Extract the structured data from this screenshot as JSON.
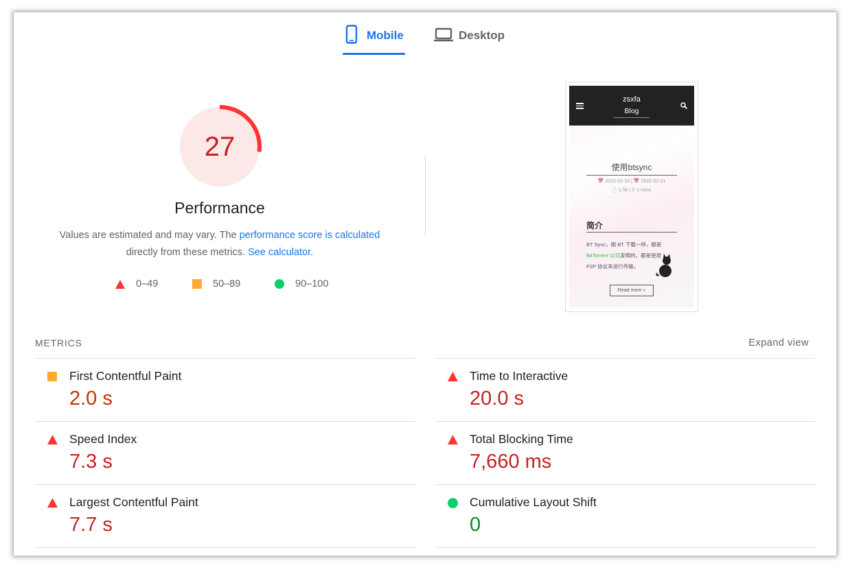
{
  "tabs": {
    "mobile_label": "Mobile",
    "desktop_label": "Desktop",
    "active": "mobile"
  },
  "score": {
    "value": "27",
    "fraction": 0.27,
    "title": "Performance",
    "desc_prefix": "Values are estimated and may vary. The ",
    "desc_link1": "performance score is calculated",
    "desc_middle": " directly from these metrics. ",
    "desc_link2": "See calculator",
    "desc_suffix": "."
  },
  "legend": {
    "poor": "0–49",
    "average": "50–89",
    "good": "90–100"
  },
  "screenshot": {
    "site_name": "zsxfa",
    "site_sub": "Blog",
    "post_title": "使用btsync",
    "meta_line1": "📅 2022-02-16  |  📅 2022-02-21",
    "meta_line2": "📄 1.5k  |  ⏱ 1 mins.",
    "section": "简介",
    "para_a": "BT Sync，跟 BT 下载一样，都是",
    "para_link": "BitTorrent 公司",
    "para_b": "发明的，都是使用",
    "para_c": "P2P 协议来进行传输。",
    "read_more": "Read more »"
  },
  "metrics": {
    "heading": "METRICS",
    "expand": "Expand view",
    "left": [
      {
        "name": "First Contentful Paint",
        "value": "2.0 s",
        "status": "average"
      },
      {
        "name": "Speed Index",
        "value": "7.3 s",
        "status": "poor"
      },
      {
        "name": "Largest Contentful Paint",
        "value": "7.7 s",
        "status": "poor"
      }
    ],
    "right": [
      {
        "name": "Time to Interactive",
        "value": "20.0 s",
        "status": "poor"
      },
      {
        "name": "Total Blocking Time",
        "value": "7,660 ms",
        "status": "poor"
      },
      {
        "name": "Cumulative Layout Shift",
        "value": "0",
        "status": "good"
      }
    ]
  },
  "colors": {
    "poor": "#ff3333",
    "average": "#ffaa33",
    "good": "#0cce6b",
    "accent": "#1a73e8"
  }
}
